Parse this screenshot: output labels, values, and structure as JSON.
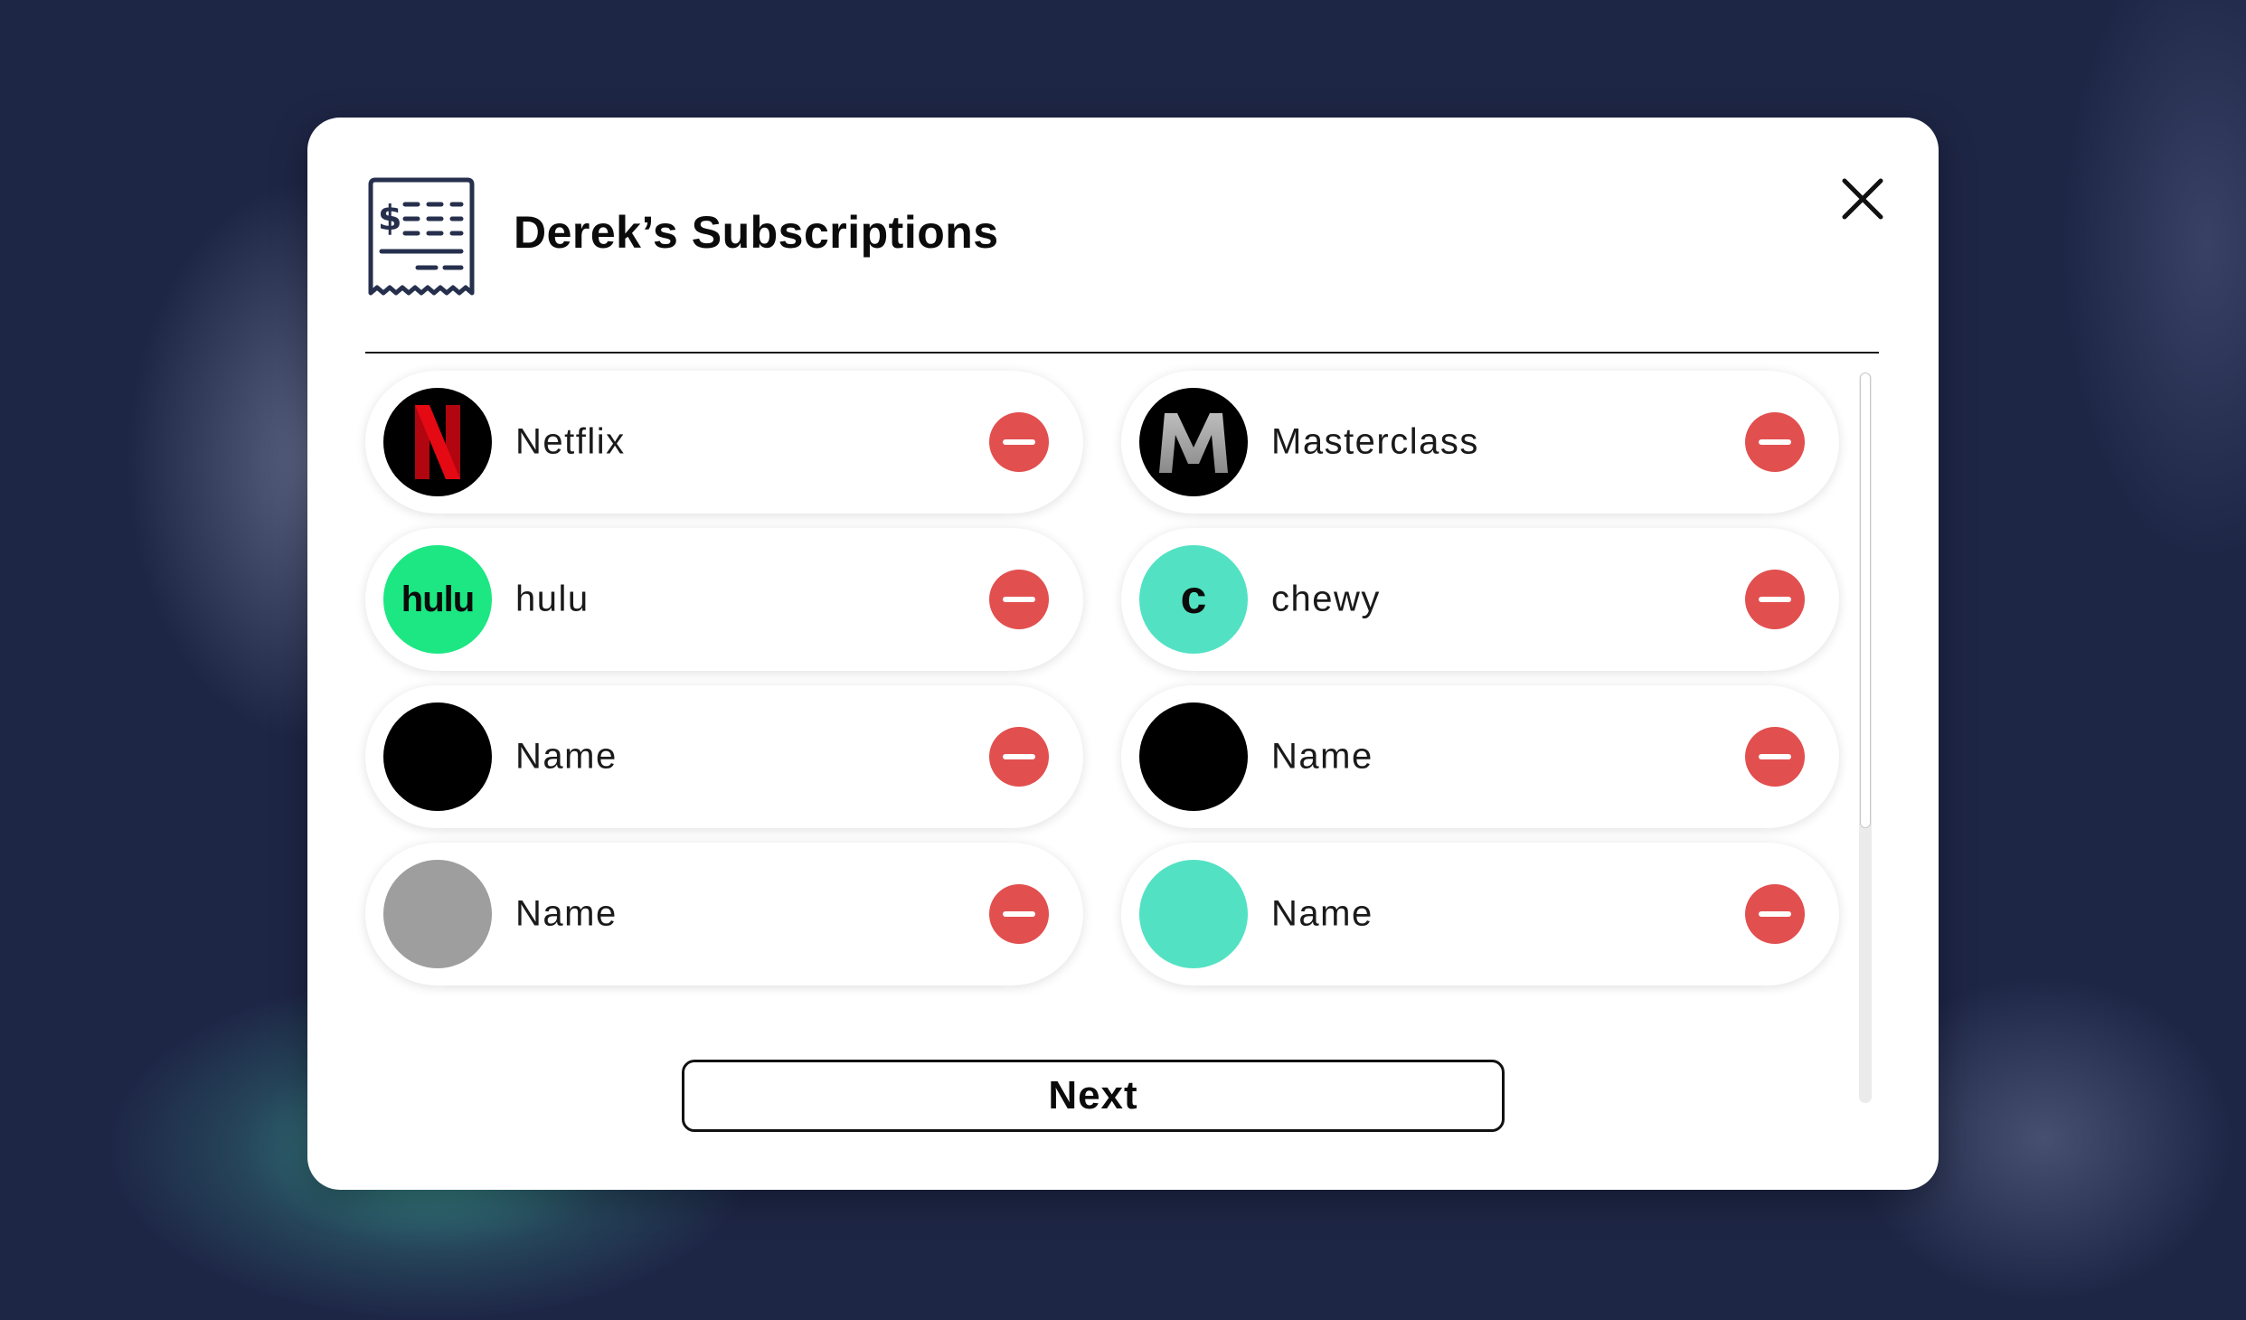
{
  "modal": {
    "title": "Derek’s Subscriptions",
    "header_icon": "receipt-icon",
    "close_icon": "close-icon",
    "next_label": "Next"
  },
  "colors": {
    "background": "#1e2646",
    "remove_button": "#e24f4f",
    "netflix_red": "#e50914",
    "hulu_green": "#1ce783",
    "chewy_teal": "#52e2c3",
    "gray_logo": "#9e9e9e"
  },
  "subscriptions": [
    {
      "name": "Netflix",
      "logo": "netflix-logo",
      "logo_bg": "#000000",
      "remove_icon": "minus-icon"
    },
    {
      "name": "Masterclass",
      "logo": "masterclass-logo",
      "logo_bg": "#000000",
      "remove_icon": "minus-icon"
    },
    {
      "name": "hulu",
      "logo": "hulu-logo",
      "logo_text": "hulu",
      "logo_bg": "#1ce783",
      "remove_icon": "minus-icon"
    },
    {
      "name": "chewy",
      "logo": "chewy-logo",
      "logo_text": "c",
      "logo_bg": "#52e2c3",
      "remove_icon": "minus-icon"
    },
    {
      "name": "Name",
      "logo": "placeholder-logo",
      "logo_bg": "#000000",
      "remove_icon": "minus-icon"
    },
    {
      "name": "Name",
      "logo": "placeholder-logo",
      "logo_bg": "#000000",
      "remove_icon": "minus-icon"
    },
    {
      "name": "Name",
      "logo": "placeholder-logo",
      "logo_bg": "#9e9e9e",
      "remove_icon": "minus-icon"
    },
    {
      "name": "Name",
      "logo": "placeholder-logo",
      "logo_bg": "#52e2c3",
      "remove_icon": "minus-icon"
    }
  ]
}
